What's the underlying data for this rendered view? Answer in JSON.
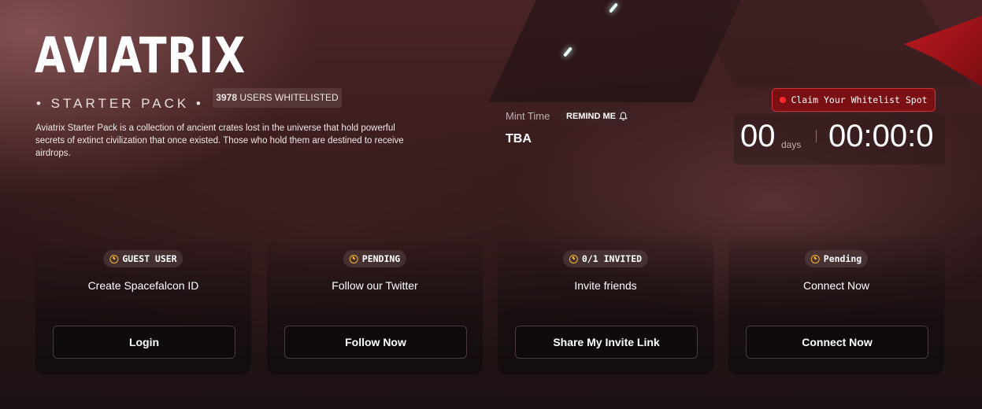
{
  "hero": {
    "title": "AVIATRIX",
    "subtitle": "• STARTER PACK •",
    "whitelisted_count": "3978",
    "whitelisted_label": "USERS WHITELISTED",
    "description": "Aviatrix Starter Pack is a collection of ancient crates lost in the universe that hold powerful secrets of extinct civilization that once existed. Those who hold them are destined to receive airdrops."
  },
  "mint": {
    "label": "Mint Time",
    "remind_label": "REMIND ME",
    "value": "TBA"
  },
  "countdown": {
    "claim_label": "Claim Your Whitelist Spot",
    "days": "00",
    "days_label": "days",
    "time": "00:00:0"
  },
  "cards": [
    {
      "status": "GUEST USER",
      "title": "Create Spacefalcon ID",
      "button": "Login"
    },
    {
      "status": "PENDING",
      "title": "Follow our Twitter",
      "button": "Follow Now"
    },
    {
      "status": "0/1 INVITED",
      "title": "Invite friends",
      "button": "Share My Invite Link"
    },
    {
      "status": "Pending",
      "title": "Connect Now",
      "button": "Connect Now"
    }
  ],
  "colors": {
    "accent_red": "#d63038",
    "clock_icon": "#f5b52b"
  },
  "icons": [
    "bell-icon",
    "clock-icon",
    "red-dot-icon"
  ]
}
